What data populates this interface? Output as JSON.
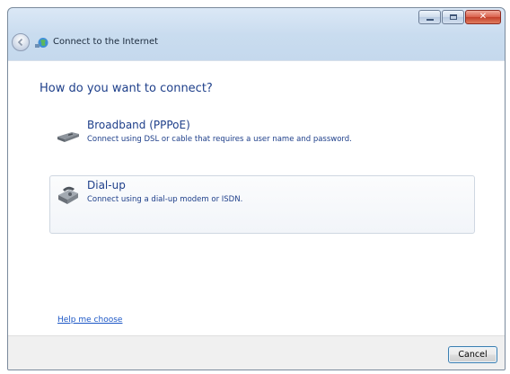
{
  "window": {
    "title": "Connect to the Internet",
    "controls": {
      "minimize": "minimize-icon",
      "maximize": "maximize-icon",
      "close": "close-icon"
    }
  },
  "main": {
    "heading": "How do you want to connect?",
    "options": [
      {
        "title": "Broadband (PPPoE)",
        "description": "Connect using DSL or cable that requires a user name and password.",
        "icon": "broadband-modem-icon",
        "selected": false
      },
      {
        "title": "Dial-up",
        "description": "Connect using a dial-up modem or ISDN.",
        "icon": "dial-up-modem-icon",
        "selected": true
      }
    ],
    "help_link": "Help me choose"
  },
  "footer": {
    "cancel_label": "Cancel"
  },
  "colors": {
    "heading": "#1e3f8a",
    "link": "#1c57c6",
    "close_button": "#c23f2a"
  }
}
